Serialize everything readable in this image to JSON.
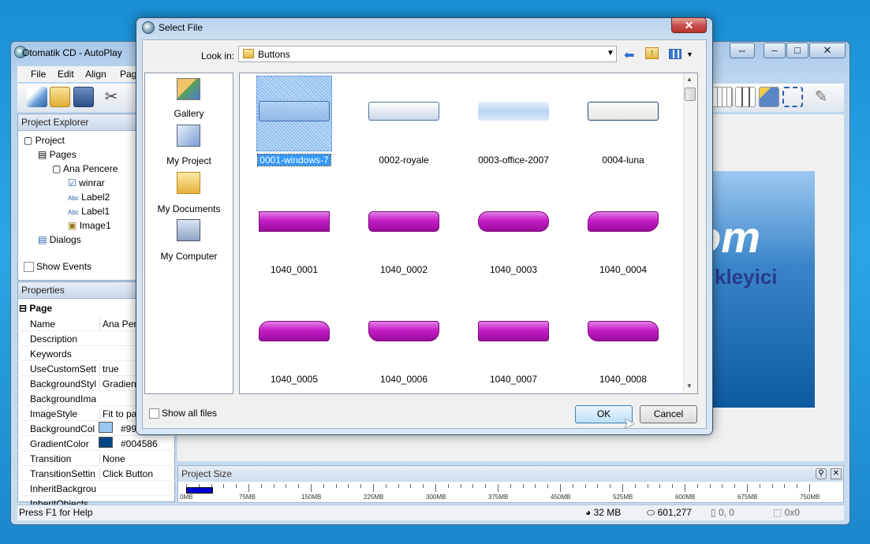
{
  "main_window": {
    "title": "Otomatik CD - AutoPlay",
    "menu": [
      "File",
      "Edit",
      "Align",
      "Pag"
    ],
    "project_explorer": {
      "header": "Project Explorer",
      "tree": [
        "Project",
        "Pages",
        "Ana Pencere",
        "winrar",
        "Label2",
        "Label1",
        "Image1",
        "Dialogs"
      ],
      "show_events": "Show Events"
    },
    "properties": {
      "header": "Properties",
      "section": "Page",
      "rows": [
        {
          "key": "Name",
          "value": "Ana Pence"
        },
        {
          "key": "Description",
          "value": ""
        },
        {
          "key": "Keywords",
          "value": ""
        },
        {
          "key": "UseCustomSett",
          "value": "true"
        },
        {
          "key": "BackgroundStyl",
          "value": "Gradient"
        },
        {
          "key": "BackgroundIma",
          "value": ""
        },
        {
          "key": "ImageStyle",
          "value": "Fit to pag"
        },
        {
          "key": "BackgroundCol",
          "value": "#99"
        },
        {
          "key": "GradientColor",
          "value": "#004586"
        },
        {
          "key": "Transition",
          "value": "None"
        },
        {
          "key": "TransitionSettin",
          "value": "Click Button"
        },
        {
          "key": "InheritBackgrou",
          "value": ""
        },
        {
          "key": "InheritObjects",
          "value": ""
        }
      ],
      "swatch_colors": [
        "#99c8ee",
        "#004586"
      ]
    },
    "canvas": {
      "text_big": "om",
      "text_sub": "kleyici"
    },
    "project_size": {
      "header": "Project Size",
      "ruler_labels": [
        "0MB",
        "75MB",
        "150MB",
        "225MB",
        "300MB",
        "375MB",
        "450MB",
        "525MB",
        "600MB",
        "675MB",
        "750MB"
      ],
      "used_fraction": 0.043
    },
    "status": {
      "help": "Press F1 for Help",
      "size": "32 MB",
      "count": "601,277",
      "pos": "0, 0",
      "dim": "0x0"
    }
  },
  "dialog": {
    "title": "Select File",
    "look_in_label": "Look in:",
    "look_in_value": "Buttons",
    "places": [
      "Gallery",
      "My Project",
      "My Documents",
      "My Computer"
    ],
    "files": [
      "0001-windows-7",
      "0002-royale",
      "0003-office-2007",
      "0004-luna",
      "1040_0001",
      "1040_0002",
      "1040_0003",
      "1040_0004",
      "1040_0005",
      "1040_0006",
      "1040_0007",
      "1040_0008"
    ],
    "show_all_files": "Show all files",
    "ok": "OK",
    "cancel": "Cancel",
    "close": "✕"
  }
}
